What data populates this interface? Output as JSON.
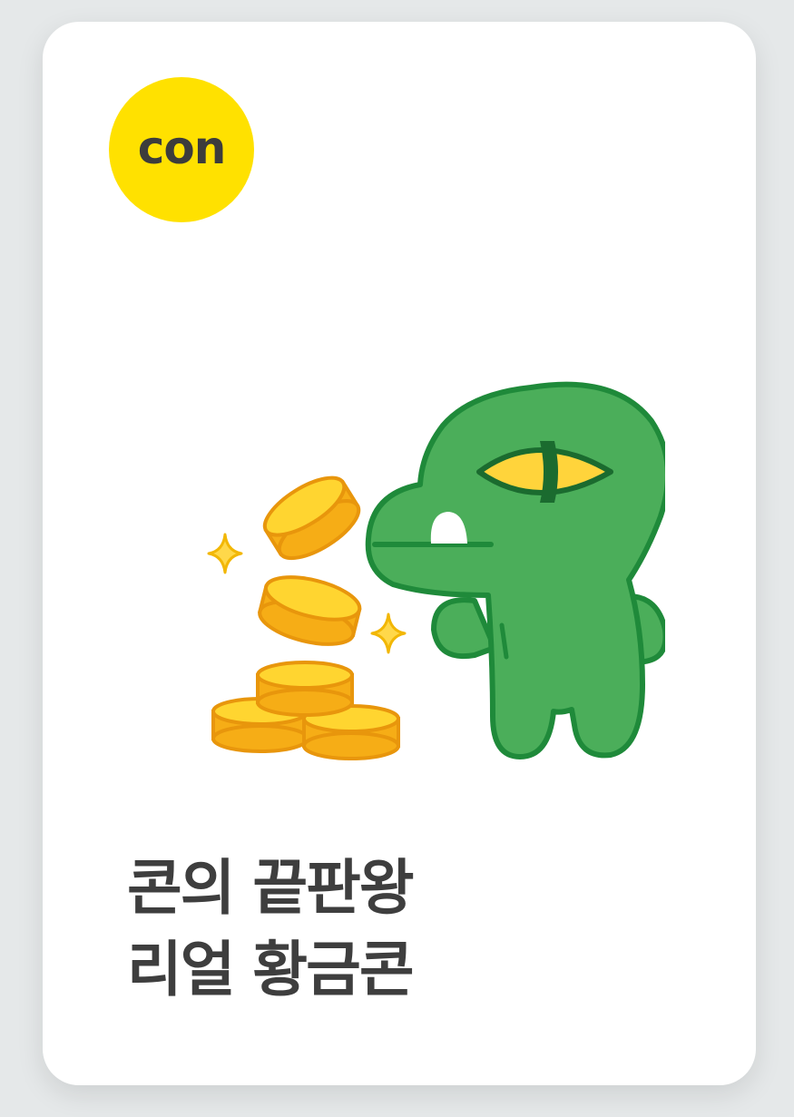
{
  "card": {
    "badge_label": "con",
    "title_lines": [
      "콘의 끝판왕",
      "리얼 황금콘"
    ],
    "illustration": "green-dinosaur-with-gold-coins"
  },
  "colors": {
    "badge": "#ffe100",
    "dino": "#4bae5a",
    "coin": "#ffcd1f",
    "title": "#3e3e3e"
  }
}
